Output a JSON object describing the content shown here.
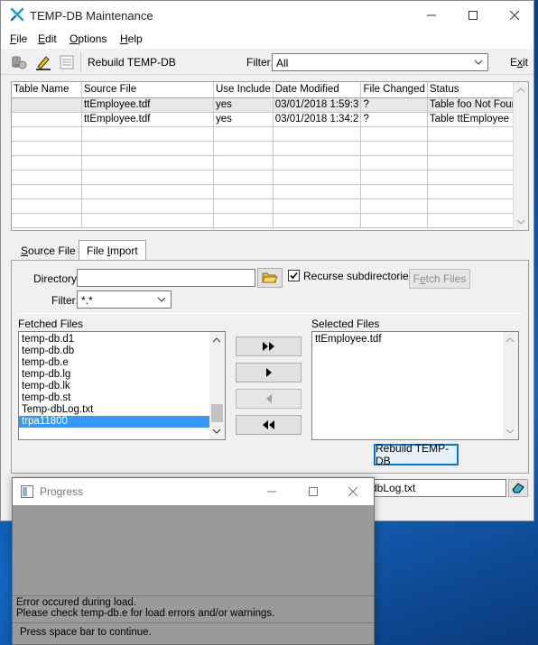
{
  "window": {
    "title": "TEMP-DB Maintenance"
  },
  "menu": [
    {
      "label": "File",
      "hotkey": "F",
      "rest": "ile"
    },
    {
      "label": "Edit",
      "hotkey": "E",
      "rest": "dit"
    },
    {
      "label": "Options",
      "hotkey": "O",
      "rest": "ptions"
    },
    {
      "label": "Help",
      "hotkey": "H",
      "rest": "elp"
    }
  ],
  "toolbar": {
    "rebuild_label": "Rebuild TEMP-DB",
    "filter_label": "Filter:",
    "filter_value": "All",
    "exit_hotkey": "x",
    "exit_prefix": "E",
    "exit_suffix": "it"
  },
  "grid": {
    "columns": [
      "Table Name",
      "Source File",
      "Use Include",
      "Date Modified",
      "File Changed",
      "Status"
    ],
    "rows": [
      [
        "",
        "ttEmployee.tdf",
        "yes",
        "03/01/2018  1:59:3",
        "?",
        "Table foo Not Found"
      ],
      [
        "",
        "ttEmployee.tdf",
        "yes",
        "03/01/2018  1:34:2",
        "?",
        "Table ttEmployee No"
      ]
    ]
  },
  "tabs": {
    "source_file": {
      "hotkey": "S",
      "rest": "ource File"
    },
    "file_import": {
      "prefix": "File ",
      "hotkey": "I",
      "rest": "mport"
    }
  },
  "import": {
    "directory_label": "Directory:",
    "directory_value": "",
    "recurse_label": "Recurse subdirectories",
    "recurse_checked": true,
    "fetch_prefix": "F",
    "fetch_hotkey": "e",
    "fetch_rest": "tch Files",
    "filter_label": "Filter:",
    "filter_value": "*.*",
    "fetched_label": "Fetched Files",
    "fetched_files": [
      "temp-db.d1",
      "temp-db.db",
      "temp-db.e",
      "temp-db.lg",
      "temp-db.lk",
      "temp-db.st",
      "Temp-dbLog.txt",
      "trpa11800"
    ],
    "fetched_selected_index": 7,
    "selected_label": "Selected Files",
    "selected_files": [
      "ttEmployee.tdf"
    ],
    "rebuild_button": "Rebuild TEMP-DB"
  },
  "log": {
    "visible_text": "dbLog.txt"
  },
  "progress": {
    "title": "Progress",
    "error_line1": "Error occured during load.",
    "error_line2": "Please check temp-db.e for load errors and/or warnings.",
    "continue_text": "Press space bar to continue."
  },
  "colors": {
    "selection": "#3399ff",
    "focus": "#0078d7",
    "accent": "#1aa3b8"
  }
}
